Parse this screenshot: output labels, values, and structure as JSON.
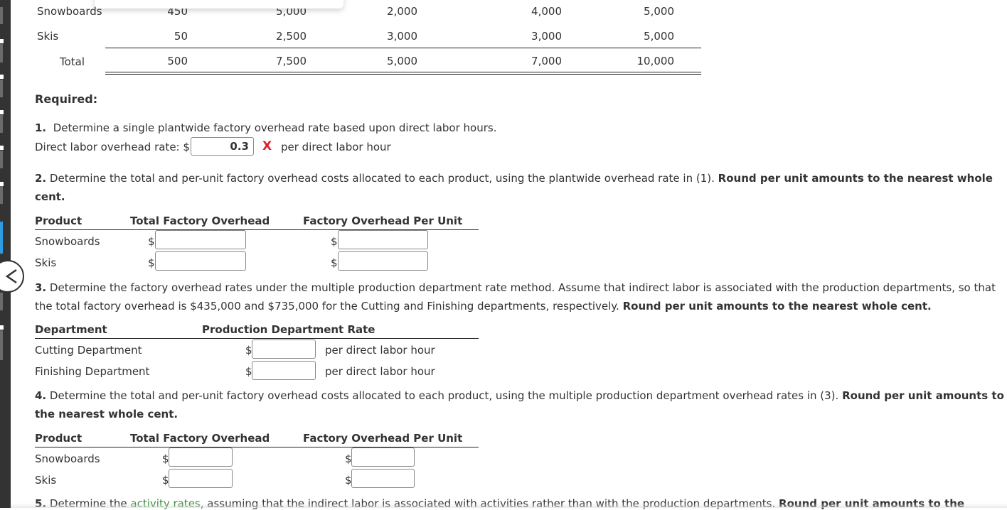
{
  "data_table": {
    "rows": [
      {
        "label": "Snowboards",
        "values": [
          "450",
          "5,000",
          "2,000",
          "4,000",
          "5,000"
        ]
      },
      {
        "label": "Skis",
        "values": [
          "50",
          "2,500",
          "3,000",
          "3,000",
          "5,000"
        ]
      },
      {
        "label": "Total",
        "values": [
          "500",
          "7,500",
          "5,000",
          "7,000",
          "10,000"
        ]
      }
    ]
  },
  "required_label": "Required:",
  "q1": {
    "number": "1.",
    "text": "Determine a single plantwide factory overhead rate based upon direct labor hours.",
    "field_label": "Direct labor overhead rate: $",
    "field_value": "0.3",
    "incorrect_mark": "X",
    "unit_text": "per direct labor hour"
  },
  "q2": {
    "number": "2.",
    "text": "Determine the total and per-unit factory overhead costs allocated to each product, using the plantwide overhead rate in (1).",
    "bold_text_line1": "Round per unit amounts to the nearest whole",
    "bold_text_line2": "cent.",
    "headers": [
      "Product",
      "Total Factory Overhead",
      "Factory Overhead Per Unit"
    ],
    "rows": [
      {
        "label": "Snowboards",
        "total": "",
        "per_unit": ""
      },
      {
        "label": "Skis",
        "total": "",
        "per_unit": ""
      }
    ],
    "currency": "$"
  },
  "q3": {
    "number": "3.",
    "text_line1": "Determine the factory overhead rates under the multiple production department rate method. Assume that indirect labor is associated with the production departments, so that",
    "text_line2": "the total factory overhead is $435,000 and $735,000 for the Cutting and Finishing departments, respectively.",
    "bold_text": "Round per unit amounts to the nearest whole cent.",
    "headers": [
      "Department",
      "Production Department Rate"
    ],
    "rows": [
      {
        "label": "Cutting Department",
        "rate": "",
        "unit_text": "per direct labor hour"
      },
      {
        "label": "Finishing Department",
        "rate": "",
        "unit_text": "per direct labor hour"
      }
    ],
    "currency": "$"
  },
  "q4": {
    "number": "4.",
    "text": "Determine the total and per-unit factory overhead costs allocated to each product, using the multiple production department overhead rates in (3).",
    "bold_text_line1": "Round per unit amounts to",
    "bold_text_line2": "the nearest whole cent.",
    "headers": [
      "Product",
      "Total Factory Overhead",
      "Factory Overhead Per Unit"
    ],
    "rows": [
      {
        "label": "Snowboards",
        "total": "",
        "per_unit": ""
      },
      {
        "label": "Skis",
        "total": "",
        "per_unit": ""
      }
    ],
    "currency": "$"
  },
  "q5": {
    "number": "5.",
    "text_before_link": "Determine the",
    "link_text": "activity rates",
    "text_after_link": ", assuming that the indirect labor is associated with activities rather than with the production departments.",
    "bold_text": "Round per unit amounts to the"
  },
  "colors": {
    "error_red": "#d9232e",
    "link_green": "#3c8a3c",
    "sidebar_dark": "#333333",
    "sidebar_blue": "#2f9be0"
  }
}
